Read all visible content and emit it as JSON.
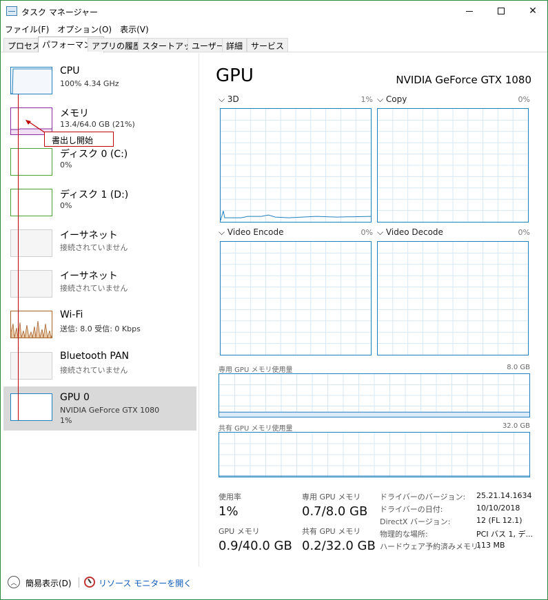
{
  "window": {
    "title": "タスク マネージャー"
  },
  "menu": [
    "ファイル(F)",
    "オプション(O)",
    "表示(V)"
  ],
  "tabs": [
    "プロセス",
    "パフォーマンス",
    "アプリの履歴",
    "スタートアップ",
    "ユーザー",
    "詳細",
    "サービス"
  ],
  "sidebar": {
    "items": [
      {
        "title": "CPU",
        "sub": "100%  4.34 GHz",
        "color": "#1f7fbf"
      },
      {
        "title": "メモリ",
        "sub": "13.4/64.0 GB (21%)",
        "color": "#8b2b9f"
      },
      {
        "title": "ディスク 0 (C:)",
        "sub": "0%",
        "color": "#4aa02c"
      },
      {
        "title": "ディスク 1 (D:)",
        "sub": "0%",
        "color": "#4aa02c"
      },
      {
        "title": "イーサネット",
        "sub": "接続されていません",
        "color": "#aaaaaa"
      },
      {
        "title": "イーサネット",
        "sub": "接続されていません",
        "color": "#aaaaaa"
      },
      {
        "title": "Wi-Fi",
        "sub": "送信: 8.0  受信: 0 Kbps",
        "color": "#a7622c"
      },
      {
        "title": "Bluetooth PAN",
        "sub": "接続されていません",
        "color": "#aaaaaa"
      },
      {
        "title": "GPU 0",
        "sub": "NVIDIA GeForce GTX 1080",
        "sub2": "1%",
        "color": "#1f7fbf"
      }
    ]
  },
  "annotation": {
    "callout": "書出し開始"
  },
  "main": {
    "heading": "GPU",
    "model": "NVIDIA GeForce GTX 1080",
    "charts": [
      {
        "label": "3D",
        "pct": "1%"
      },
      {
        "label": "Copy",
        "pct": "0%"
      },
      {
        "label": "Video Encode",
        "pct": "0%"
      },
      {
        "label": "Video Decode",
        "pct": "0%"
      }
    ],
    "dedicated_mem": {
      "label": "専用 GPU メモリ使用量",
      "max": "8.0 GB"
    },
    "shared_mem": {
      "label": "共有 GPU メモリ使用量",
      "max": "32.0 GB"
    },
    "stats": {
      "usage_label": "使用率",
      "usage_value": "1%",
      "dedicated_label": "専用 GPU メモリ",
      "dedicated_value": "0.7/8.0 GB",
      "gpu_mem_label": "GPU メモリ",
      "gpu_mem_value": "0.9/40.0 GB",
      "shared_label": "共有 GPU メモリ",
      "shared_value": "0.2/32.0 GB"
    },
    "info": [
      {
        "label": "ドライバーのバージョン:",
        "value": "25.21.14.1634"
      },
      {
        "label": "ドライバーの日付:",
        "value": "10/10/2018"
      },
      {
        "label": "DirectX バージョン:",
        "value": "12 (FL 12.1)"
      },
      {
        "label": "物理的な場所:",
        "value": "PCI バス 1, デ..."
      },
      {
        "label": "ハードウェア予約済みメモリ:",
        "value": "113 MB"
      }
    ]
  },
  "bottom": {
    "fewer_details": "簡易表示(D)",
    "resource_monitor": "リソース モニターを開く"
  },
  "colors": {
    "accent": "#1f7fbf",
    "annotation": "#c00000"
  }
}
